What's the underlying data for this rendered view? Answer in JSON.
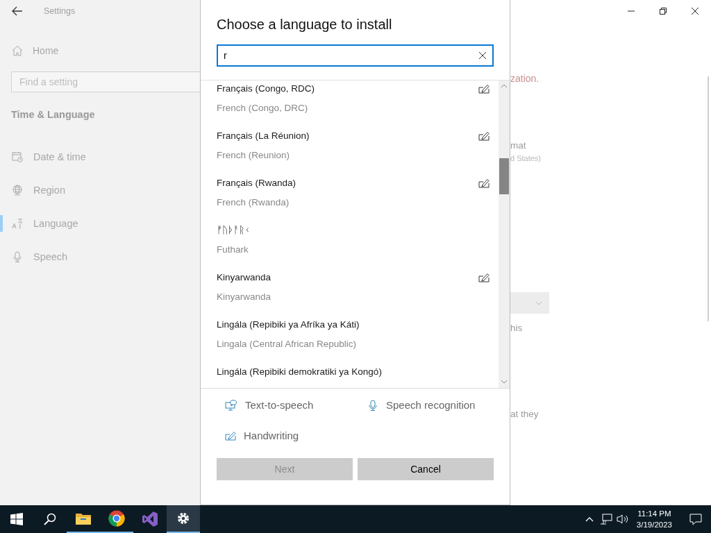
{
  "window": {
    "title": "Settings"
  },
  "sidebar": {
    "home": "Home",
    "search": {
      "placeholder": "Find a setting"
    },
    "section": "Time & Language",
    "items": [
      {
        "label": "Date & time",
        "selected": false
      },
      {
        "label": "Region",
        "selected": false
      },
      {
        "label": "Language",
        "selected": true
      },
      {
        "label": "Speech",
        "selected": false
      }
    ]
  },
  "background_pane": {
    "fragments": [
      {
        "kind": "warning",
        "text": "zation."
      },
      {
        "kind": "label",
        "text": "mat"
      },
      {
        "kind": "caption",
        "text": "d States)"
      },
      {
        "kind": "dropdown"
      },
      {
        "kind": "label",
        "text": "his"
      },
      {
        "kind": "label",
        "text": "at they"
      }
    ]
  },
  "dialog": {
    "title": "Choose a language to install",
    "search": {
      "value": "r"
    },
    "languages": [
      {
        "name": "Français (Congo, RDC)",
        "translation": "French (Congo, DRC)",
        "handwriting": true
      },
      {
        "name": "Français (La Réunion)",
        "translation": "French (Reunion)",
        "handwriting": true
      },
      {
        "name": "Français (Rwanda)",
        "translation": "French (Rwanda)",
        "handwriting": true
      },
      {
        "name": "ᚠᚢᚦᚨᚱᚲ",
        "translation": "Futhark",
        "handwriting": false
      },
      {
        "name": "Kinyarwanda",
        "translation": "Kinyarwanda",
        "handwriting": true
      },
      {
        "name": "Lingála (Repibiki ya Afríka ya Káti)",
        "translation": "Lingala (Central African Republic)",
        "handwriting": false
      },
      {
        "name": "Lingála (Repibiki demokratiki ya Kongó)",
        "handwriting": false
      }
    ],
    "features": [
      {
        "kind": "text-to-speech",
        "label": "Text-to-speech"
      },
      {
        "kind": "speech-recognition",
        "label": "Speech recognition"
      },
      {
        "kind": "handwriting",
        "label": "Handwriting"
      }
    ],
    "buttons": [
      {
        "label": "Next",
        "disabled": true
      },
      {
        "label": "Cancel",
        "disabled": false
      }
    ]
  },
  "taskbar": {
    "apps": [
      {
        "kind": "start",
        "running": false,
        "selected": false
      },
      {
        "kind": "search",
        "running": false,
        "selected": false
      },
      {
        "kind": "folder",
        "running": true,
        "selected": false
      },
      {
        "kind": "browser",
        "running": true,
        "selected": false
      },
      {
        "kind": "ide",
        "running": false,
        "selected": false
      },
      {
        "kind": "settings",
        "running": true,
        "selected": true
      }
    ],
    "time": "11:14 PM",
    "date": "3/19/2023"
  }
}
